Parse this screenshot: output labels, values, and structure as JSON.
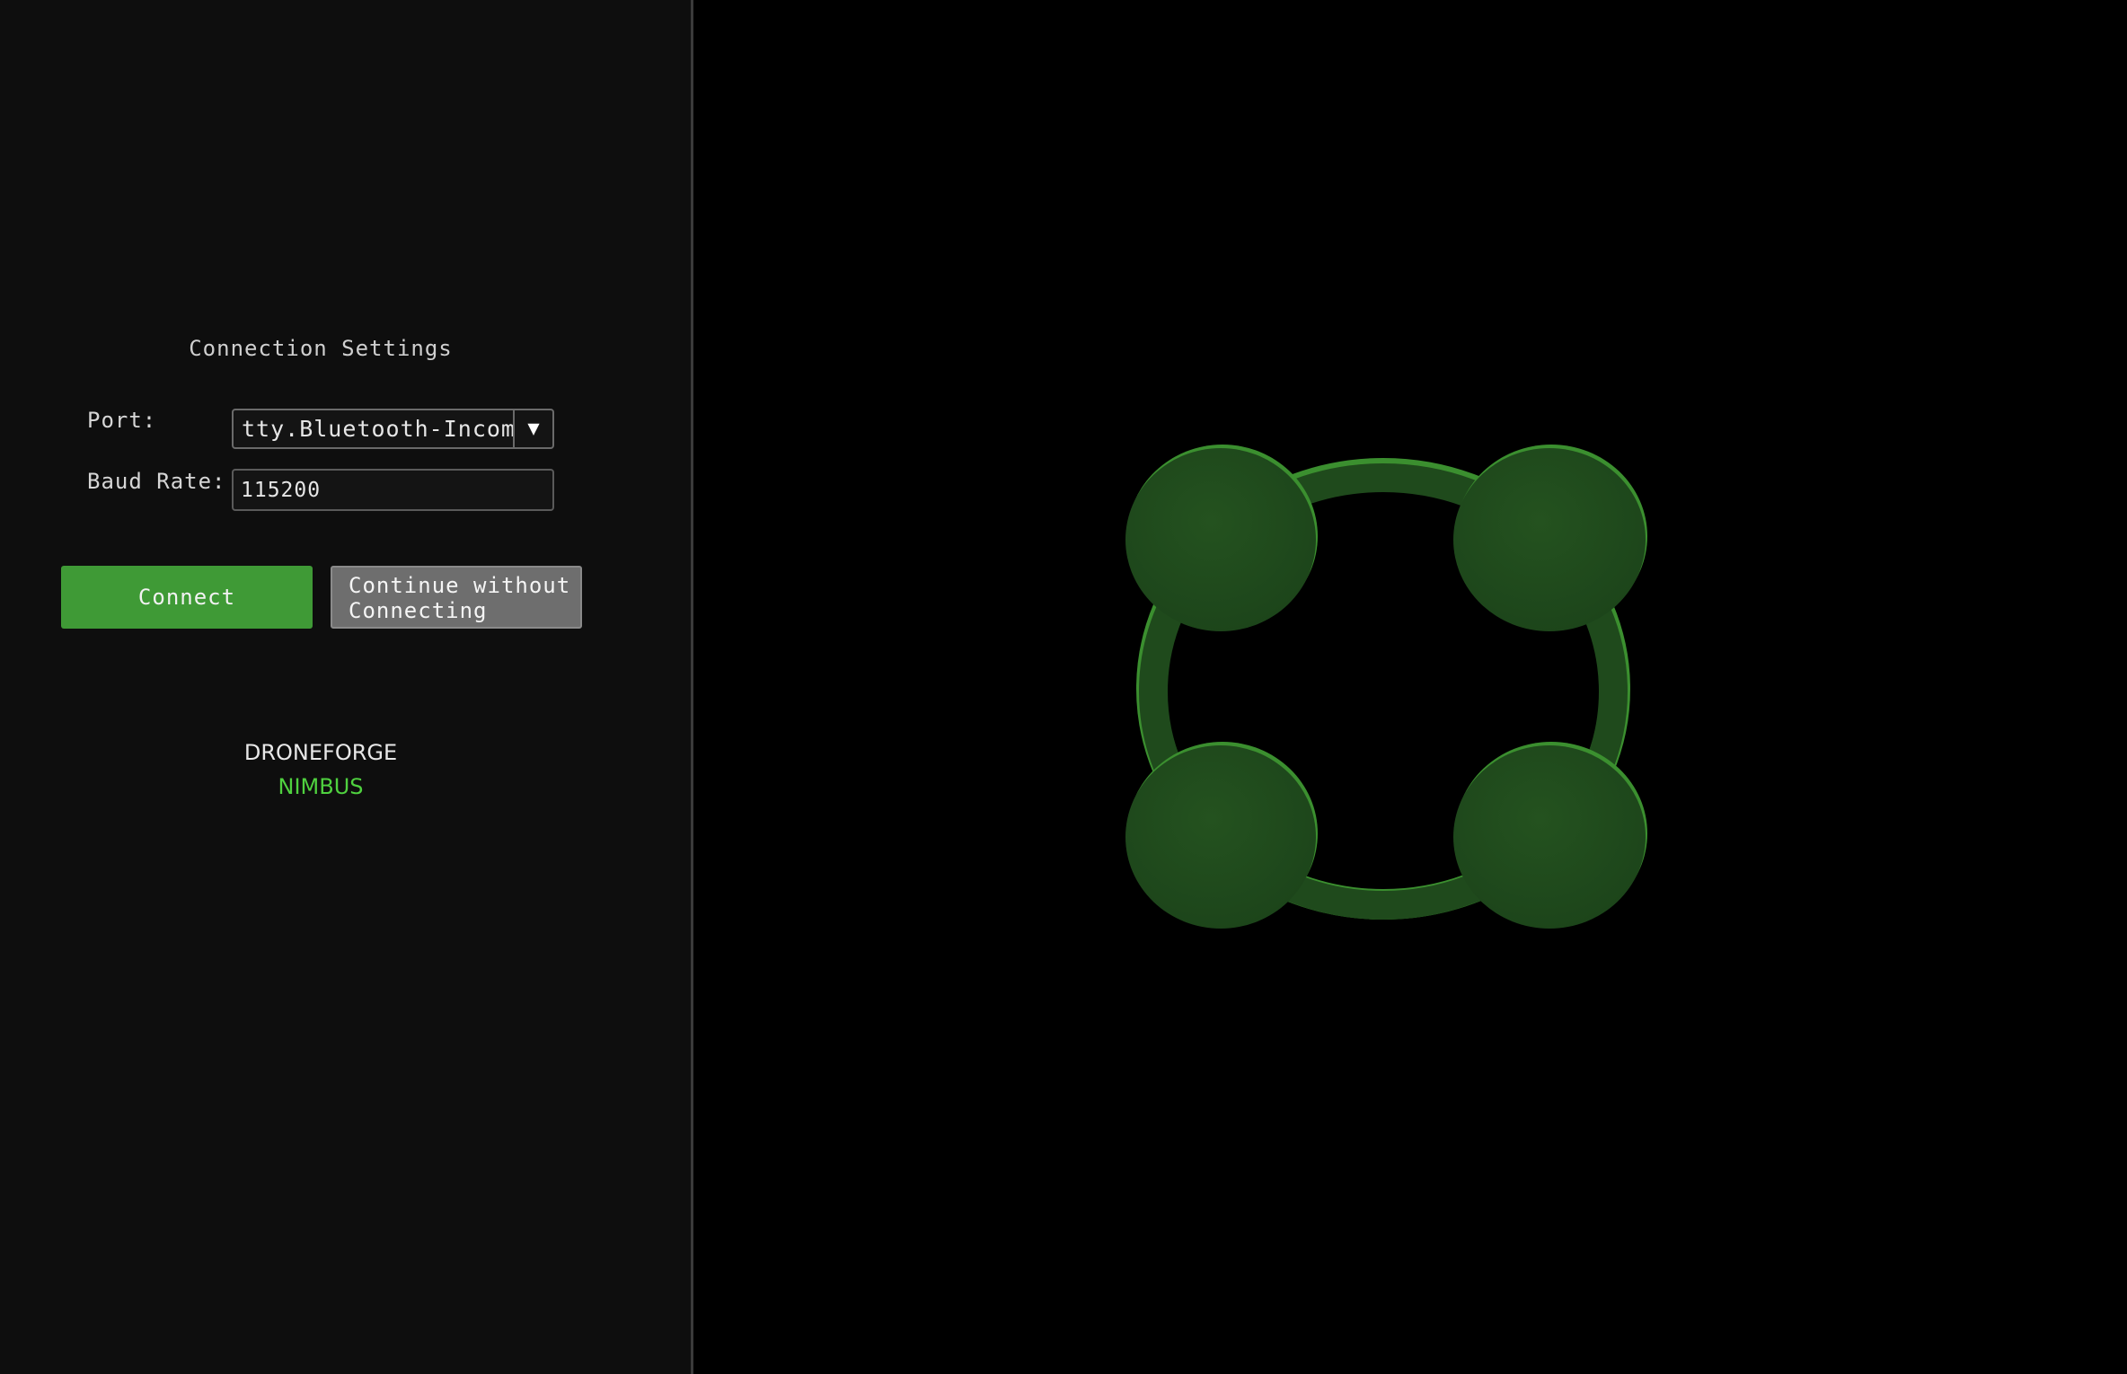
{
  "connection": {
    "title": "Connection Settings",
    "port_label": "Port:",
    "port_value": "tty.Bluetooth-Incomi",
    "port_dropdown_icon": "triangle-down-icon",
    "baud_label": "Baud Rate:",
    "baud_value": "115200"
  },
  "buttons": {
    "connect_label": "Connect",
    "continue_label_line1": "Continue without",
    "continue_label_line2": "Connecting"
  },
  "brand": {
    "line1": "DRONEFORGE",
    "line2": "NIMBUS"
  },
  "colors": {
    "panel_bg": "#0e0e0e",
    "connect_green": "#3f9a36",
    "continue_gray": "#6e6e6e",
    "brand_accent": "#4fd13f",
    "drone_body": "#1f4a1c",
    "drone_highlight": "#3b8f2f"
  }
}
